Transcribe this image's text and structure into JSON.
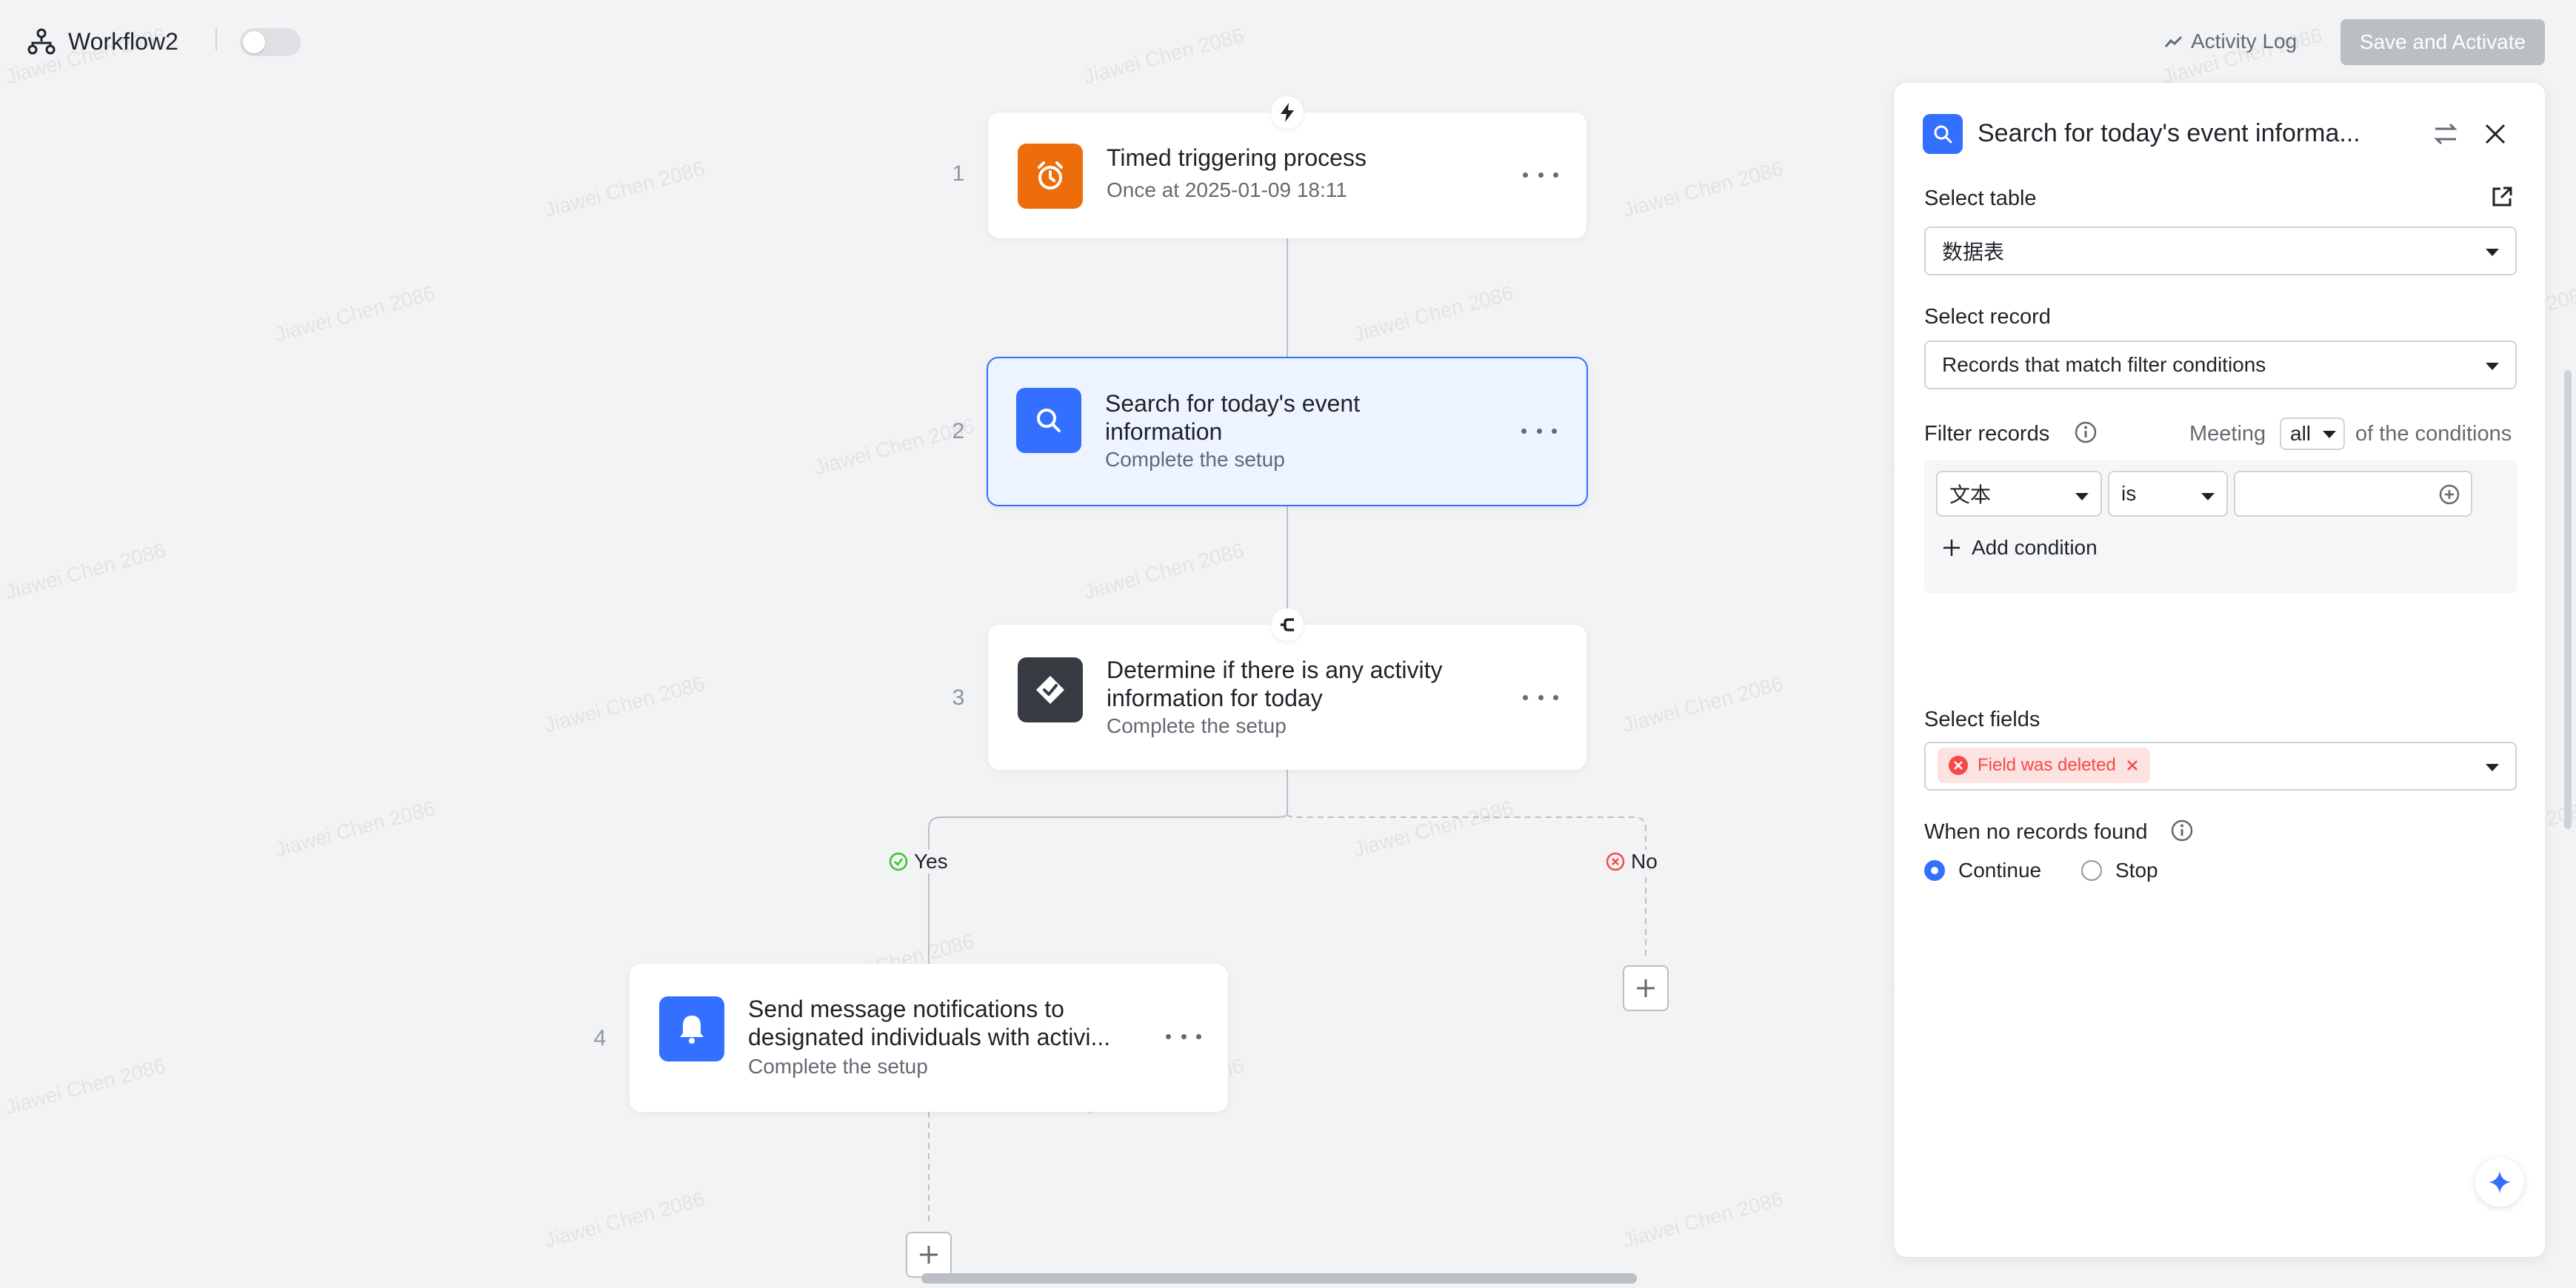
{
  "header": {
    "title": "Workflow2",
    "activity_log": "Activity Log",
    "save_button": "Save and Activate"
  },
  "watermark": "Jiawei Chen 2086",
  "nodes": [
    {
      "num": "1",
      "title": "Timed triggering process",
      "subtitle": "Once at 2025-01-09 18:11",
      "icon": "alarm-clock-icon"
    },
    {
      "num": "2",
      "title": "Search for today's event information",
      "subtitle": "Complete the setup",
      "icon": "search-icon"
    },
    {
      "num": "3",
      "title": "Determine if there is any activity information for today",
      "subtitle": "Complete the setup",
      "icon": "condition-icon"
    },
    {
      "num": "4",
      "title": "Send message notifications to designated individuals with activi...",
      "subtitle": "Complete the setup",
      "icon": "bell-icon"
    }
  ],
  "branches": {
    "yes": "Yes",
    "no": "No"
  },
  "panel": {
    "title": "Search for today's event informa...",
    "select_table_label": "Select table",
    "select_table_value": "数据表",
    "select_record_label": "Select record",
    "select_record_value": "Records that match filter conditions",
    "filter_label": "Filter records",
    "meeting": "Meeting",
    "meeting_value": "all",
    "of_conditions": "of the conditions",
    "condition_field": "文本",
    "condition_op": "is",
    "condition_value": "",
    "add_condition": "Add condition",
    "select_fields_label": "Select fields",
    "field_tag": "Field was deleted",
    "no_records_label": "When no records found",
    "option_continue": "Continue",
    "option_stop": "Stop",
    "selected_option": "Continue"
  },
  "colors": {
    "accent": "#3370ff",
    "trigger": "#ed6d0c",
    "condition": "#373c43",
    "error": "#f54a45"
  }
}
